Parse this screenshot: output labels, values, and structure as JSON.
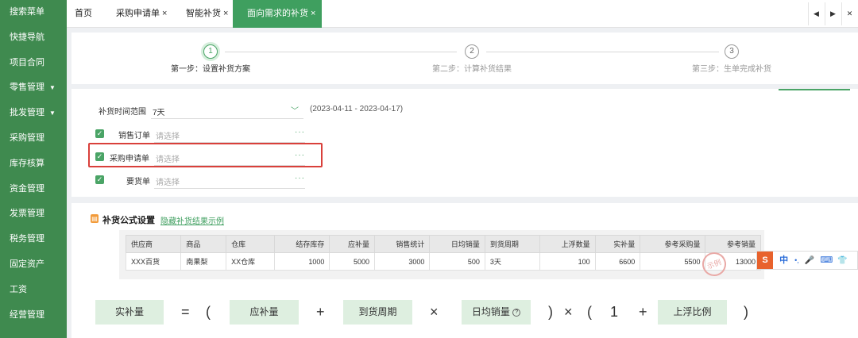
{
  "sidebar": {
    "items": [
      {
        "label": "搜索菜单",
        "arrow": ""
      },
      {
        "label": "快捷导航",
        "arrow": ""
      },
      {
        "label": "项目合同",
        "arrow": ""
      },
      {
        "label": "零售管理",
        "arrow": "▼"
      },
      {
        "label": "批发管理",
        "arrow": "▼"
      },
      {
        "label": "采购管理",
        "arrow": ""
      },
      {
        "label": "库存核算",
        "arrow": ""
      },
      {
        "label": "资金管理",
        "arrow": ""
      },
      {
        "label": "发票管理",
        "arrow": ""
      },
      {
        "label": "税务管理",
        "arrow": ""
      },
      {
        "label": "固定资产",
        "arrow": ""
      },
      {
        "label": "工资",
        "arrow": ""
      },
      {
        "label": "经营管理",
        "arrow": ""
      }
    ]
  },
  "tabs": [
    {
      "label": "首页",
      "close": ""
    },
    {
      "label": "采购申请单",
      "close": "×"
    },
    {
      "label": "智能补货",
      "close": "×"
    },
    {
      "label": "面向需求的补货",
      "close": "×"
    }
  ],
  "tab_nav": {
    "prev": "◀",
    "next": "▶",
    "close": "✕"
  },
  "steps": [
    {
      "num": "1",
      "label": "第一步：设置补货方案"
    },
    {
      "num": "2",
      "label": "第二步：计算补货结果"
    },
    {
      "num": "3",
      "label": "第三步：生单完成补货"
    }
  ],
  "form": {
    "range_label": "补货时间范围",
    "range_value": "7天",
    "chevron": "﹀",
    "range_dates": "(2023-04-11   -   2023-04-17)",
    "sources": [
      {
        "label": "销售订单",
        "placeholder": "请选择"
      },
      {
        "label": "采购申请单",
        "placeholder": "请选择"
      },
      {
        "label": "要货单",
        "placeholder": "请选择"
      }
    ],
    "dots": "···",
    "check": "✓"
  },
  "formula_section": {
    "icon": "▤",
    "title": "补货公式设置",
    "link": "隐藏补货结果示例"
  },
  "example_table": {
    "headers": [
      "供应商",
      "商品",
      "仓库",
      "结存库存",
      "应补量",
      "销售统计",
      "日均销量",
      "到货周期",
      "上浮数量",
      "实补量",
      "参考采购量",
      "参考销量"
    ],
    "row": [
      "XXX百货",
      "南果梨",
      "XX仓库",
      "1000",
      "5000",
      "3000",
      "500",
      "3天",
      "100",
      "6600",
      "5500",
      "13000"
    ]
  },
  "stamp_text": "示例",
  "ime": {
    "logo": "S",
    "lang": "中",
    "punct": "•,",
    "mic": "🎤",
    "kbd": "⌨",
    "shirt": "👕"
  },
  "formula": {
    "result": "实补量",
    "eq": "=",
    "lp1": "(",
    "term1": "应补量",
    "plus1": "+",
    "term2": "到货周期",
    "times1": "×",
    "term3": "日均销量",
    "help": "?",
    "rp1": ")",
    "times2": "×",
    "lp2": "(",
    "one": "1",
    "plus2": "+",
    "term4": "上浮比例",
    "rp2": ")"
  }
}
